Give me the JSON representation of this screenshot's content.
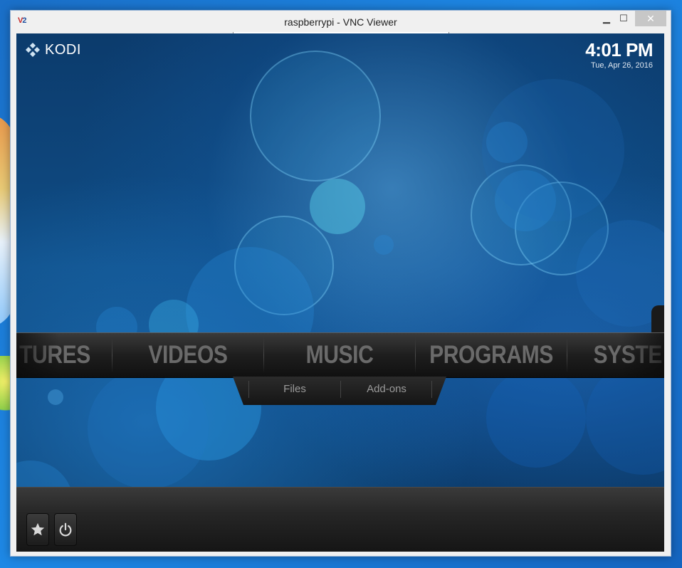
{
  "window": {
    "title": "raspberrypi - VNC Viewer",
    "app_icon_label": "V2",
    "minimize": "▁",
    "maximize": "☐",
    "close": "✕"
  },
  "kodi": {
    "logo_text": "KODI",
    "clock": {
      "time": "4:01 PM",
      "date": "Tue, Apr 26, 2016"
    },
    "main_menu": [
      {
        "label": "TURES"
      },
      {
        "label": "VIDEOS"
      },
      {
        "label": "MUSIC"
      },
      {
        "label": "PROGRAMS"
      },
      {
        "label": "SYSTE"
      }
    ],
    "submenu": [
      {
        "label": "Files"
      },
      {
        "label": "Add-ons"
      }
    ],
    "bottom_buttons": [
      {
        "name": "favourites",
        "icon": "star-icon"
      },
      {
        "name": "power",
        "icon": "power-icon"
      }
    ]
  },
  "colors": {
    "menu_text": "#6a6a6a",
    "accent_blue": "#1a6fc8"
  }
}
